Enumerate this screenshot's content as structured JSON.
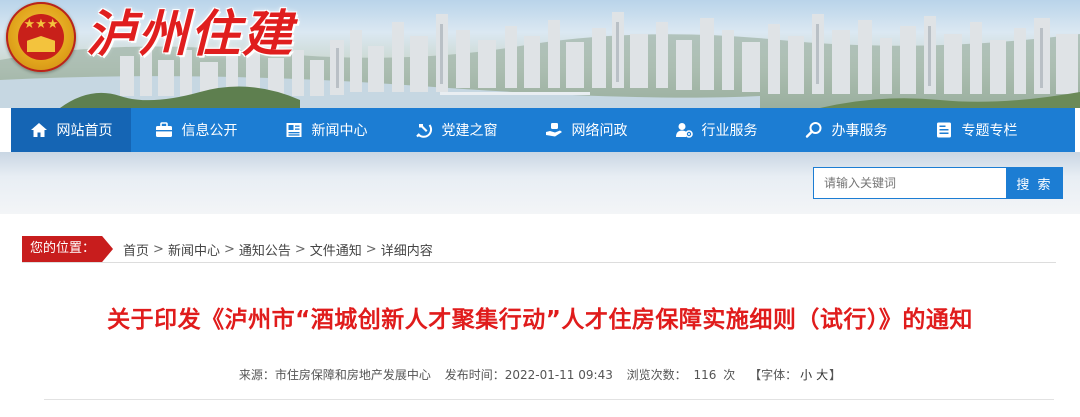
{
  "brand": {
    "site_title": "泸州住建"
  },
  "nav": {
    "items": [
      {
        "label": "网站首页",
        "icon": "home-icon"
      },
      {
        "label": "信息公开",
        "icon": "briefcase-icon"
      },
      {
        "label": "新闻中心",
        "icon": "newspaper-icon"
      },
      {
        "label": "党建之窗",
        "icon": "hammer-sickle-icon"
      },
      {
        "label": "网络问政",
        "icon": "hand-icon"
      },
      {
        "label": "行业服务",
        "icon": "user-gear-icon"
      },
      {
        "label": "办事服务",
        "icon": "search-icon"
      },
      {
        "label": "专题专栏",
        "icon": "special-topic-icon"
      }
    ],
    "accent": "#1c7dd3",
    "active_color": "#1565b4"
  },
  "search": {
    "placeholder": "请输入关键词",
    "button_label": "搜 索"
  },
  "breadcrumb": {
    "label": "您的位置：",
    "items": [
      "首页",
      "新闻中心",
      "通知公告",
      "文件通知",
      "详细内容"
    ],
    "separator": ">"
  },
  "article": {
    "title": "关于印发《泸州市“酒城创新人才聚集行动”人才住房保障实施细则（试行）》的通知",
    "source_label": "来源：",
    "source": "市住房保障和房地产发展中心",
    "time_label": "发布时间：",
    "time": "2022-01-11 09:43",
    "views_label": "浏览次数：",
    "views": "116",
    "views_unit": "次",
    "font_label": "【字体：",
    "font_small": "小",
    "font_large": "大",
    "font_close": "】"
  },
  "colors": {
    "title_red": "#e01c1c",
    "label_red": "#c81d1d"
  }
}
